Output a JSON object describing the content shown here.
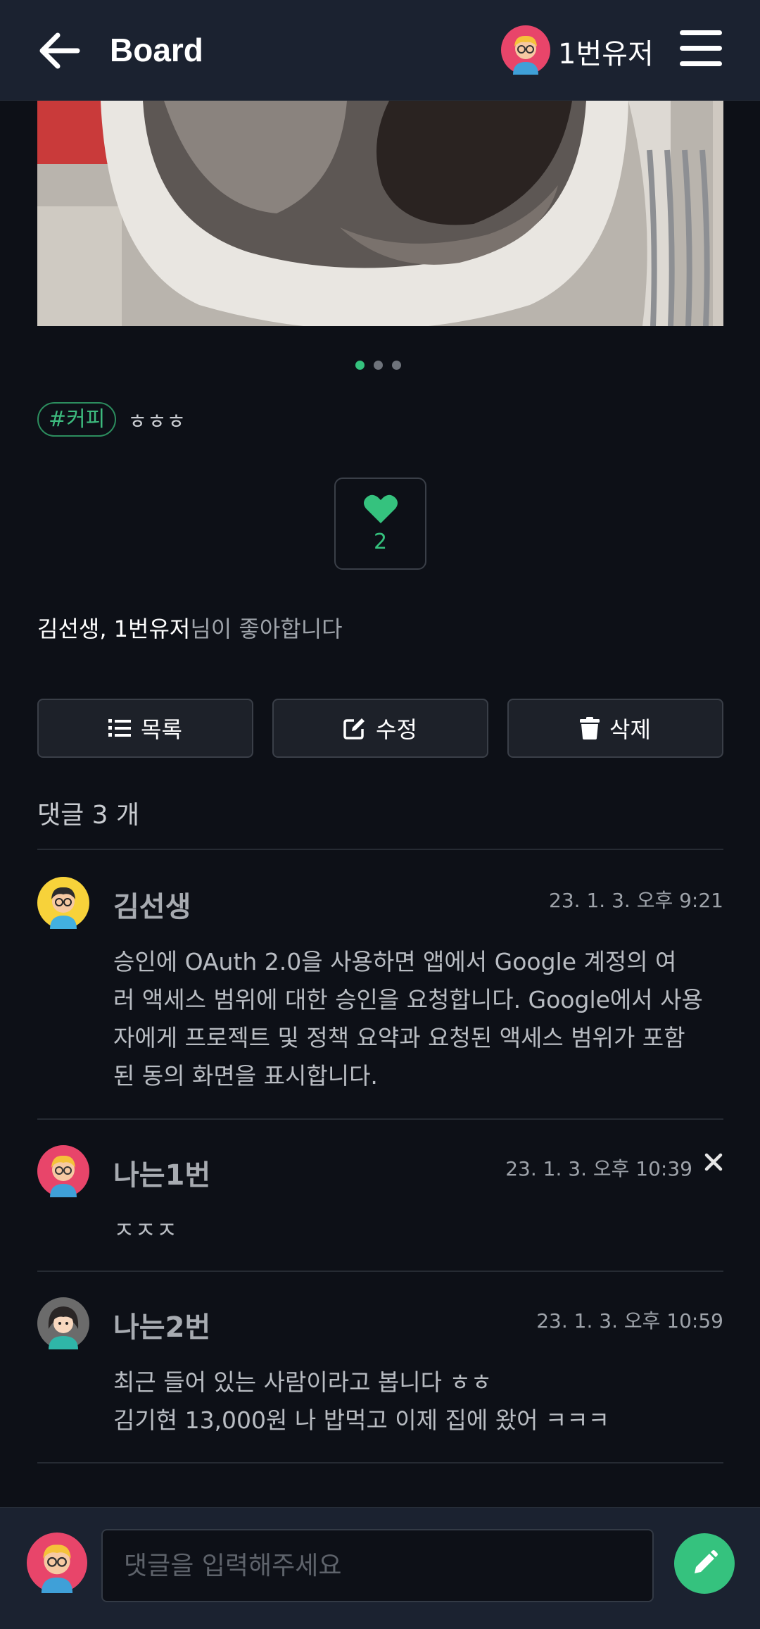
{
  "header": {
    "title": "Board",
    "user_name": "1번유저"
  },
  "carousel": {
    "count": 3,
    "active_index": 0
  },
  "tags": {
    "chip": "#커피",
    "text": "ㅎㅎㅎ"
  },
  "like": {
    "count": "2"
  },
  "likers": {
    "names": "김선생, 1번유저",
    "suffix": "님이 좋아합니다"
  },
  "actions": {
    "list_label": "목록",
    "edit_label": "수정",
    "delete_label": "삭제"
  },
  "comments_header": "댓글 3 개",
  "comments": [
    {
      "author": "김선생",
      "time": "23. 1. 3. 오후 9:21",
      "lines": [
        "승인에 OAuth 2.0을 사용하면 앱에서 Google 계정의 여",
        "러 액세스 범위에 대한 승인을 요청합니다. Google에서 사용",
        "자에게 프로젝트 및 정책 요약과 요청된 액세스 범위가 포함",
        "된 동의 화면을 표시합니다."
      ],
      "avatar": "avatar-yellow-glasses"
    },
    {
      "author": "나는1번",
      "time": "23. 1. 3. 오후 10:39",
      "lines": [
        "ㅈㅈㅈ"
      ],
      "avatar": "avatar-pink-glasses"
    },
    {
      "author": "나는2번",
      "time": "23. 1. 3. 오후 10:59",
      "lines": [
        "최근 들어 있는 사람이라고 봅니다 ㅎㅎ",
        "김기현 13,000원 나 밥먹고 이제 집에 왔어 ㅋㅋㅋ"
      ],
      "avatar": "avatar-gray-woman"
    }
  ],
  "comment_input": {
    "placeholder": "댓글을 입력해주세요",
    "value": ""
  },
  "colors": {
    "accent": "#35c27e",
    "background": "#0d1017",
    "bar": "#1b2230"
  }
}
